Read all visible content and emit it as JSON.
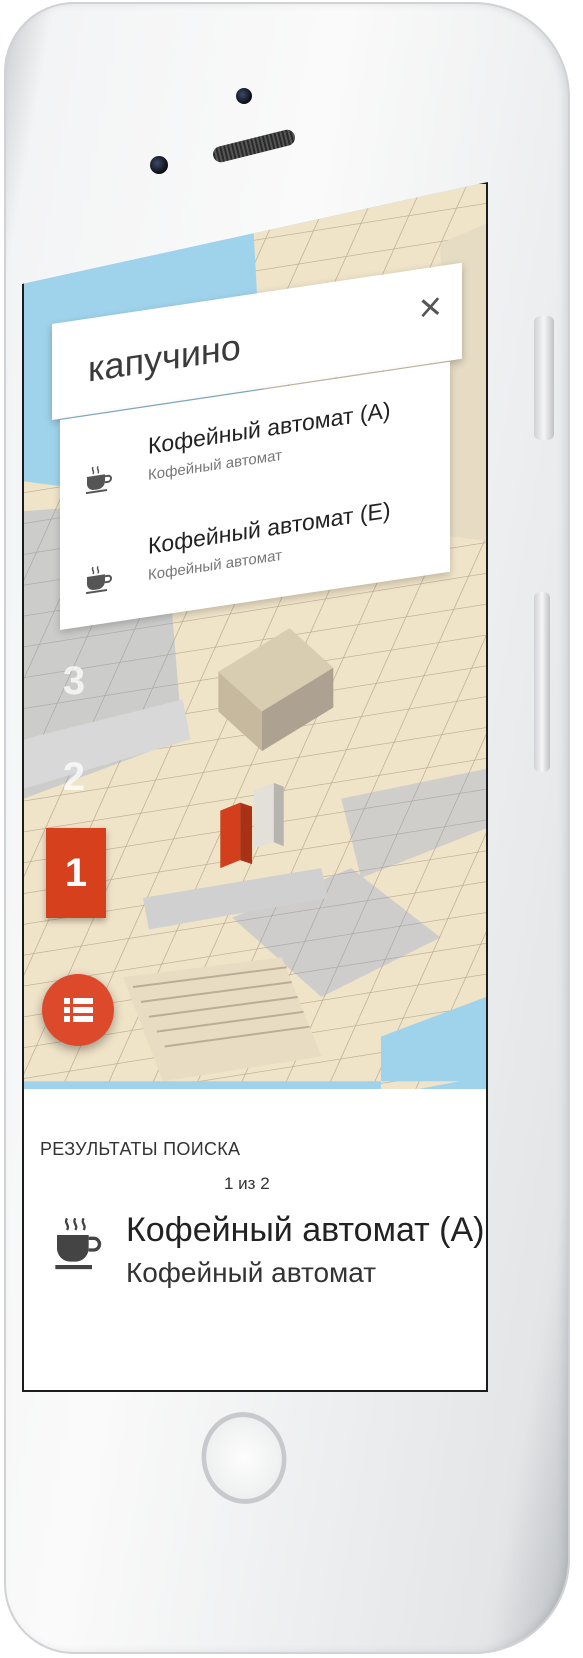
{
  "search": {
    "query": "капучино",
    "close_symbol": "×"
  },
  "suggestions": [
    {
      "title": "Кофейный автомат (A)",
      "subtitle": "Кофейный автомат",
      "icon": "coffee-cup-icon"
    },
    {
      "title": "Кофейный автомат (E)",
      "subtitle": "Кофейный автомат",
      "icon": "coffee-cup-icon"
    }
  ],
  "floors": [
    "3",
    "2",
    "1"
  ],
  "active_floor": "1",
  "results": {
    "title": "РЕЗУЛЬТАТЫ ПОИСКА",
    "count": "1 из 2",
    "item": {
      "title": "Кофейный автомат (A)",
      "subtitle": "Кофейный автомат",
      "icon": "coffee-cup-icon"
    }
  },
  "colors": {
    "accent": "#d6401d",
    "water": "#9fd3ec",
    "floor_tile": "#efe3c8",
    "wall": "#d8d8d8"
  }
}
